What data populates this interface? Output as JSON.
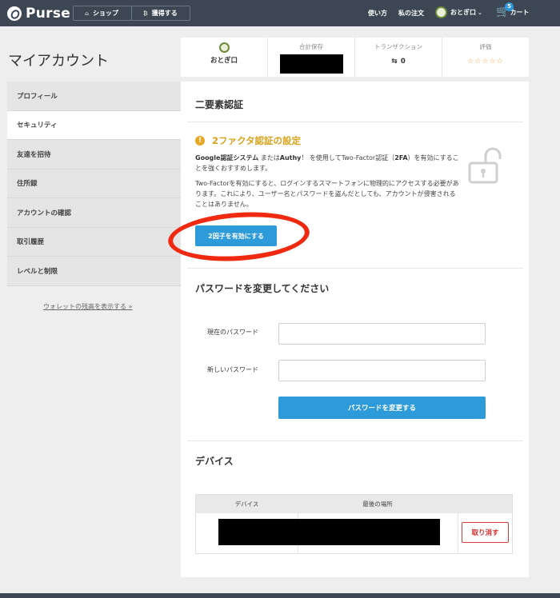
{
  "header": {
    "logo_text": "Purse",
    "shop_label": "ショップ",
    "earn_label": "獲得する",
    "howto_label": "使い方",
    "orders_label": "私の注文",
    "username": "おとぎ口",
    "cart_label": "カート",
    "cart_count": "5"
  },
  "sidebar": {
    "page_title": "マイアカウント",
    "items": [
      {
        "label": "プロフィール"
      },
      {
        "label": "セキュリティ"
      },
      {
        "label": "友達を招待"
      },
      {
        "label": "住所録"
      },
      {
        "label": "アカウントの確認"
      },
      {
        "label": "取引履歴"
      },
      {
        "label": "レベルと制限"
      }
    ],
    "wallet_link": "ウォレットの残高を表示する »"
  },
  "stats": {
    "user_name": "おとぎ口",
    "total_title": "合計保存",
    "tx_title": "トランザクション",
    "tx_value": "0",
    "rating_title": "評価",
    "rating_stars": "☆☆☆☆☆"
  },
  "two_factor": {
    "section_title": "二要素認証",
    "warning_title": "2ファクタ認証の設定",
    "p1_bold1": "Google認証システム",
    "p1_mid1": " または",
    "p1_bold2": "Authy",
    "p1_mid2": "！ を使用してTwo-Factor認証（",
    "p1_bold3": "2FA",
    "p1_end": "）を有効にすることを強くおすすめします。",
    "p2": "Two-Factorを有効にすると、ログインするスマートフォンに物理的にアクセスする必要があります。これにより、ユーザー名とパスワードを盗んだとしても、アカウントが侵害されることはありません。",
    "enable_button": "2因子を有効にする"
  },
  "password": {
    "section_title": "パスワードを変更してください",
    "current_label": "現在のパスワード",
    "new_label": "新しいパスワード",
    "current_value": "",
    "new_value": "",
    "submit_button": "パスワードを変更する"
  },
  "devices": {
    "section_title": "デバイス",
    "col_device": "デバイス",
    "col_location": "最後の場所",
    "revoke_button": "取り消す"
  },
  "colors": {
    "nav_bg": "#3c4753",
    "accent_blue": "#2d9ad9",
    "warning_gold": "#d9a21b",
    "danger_red": "#d62a2a"
  }
}
